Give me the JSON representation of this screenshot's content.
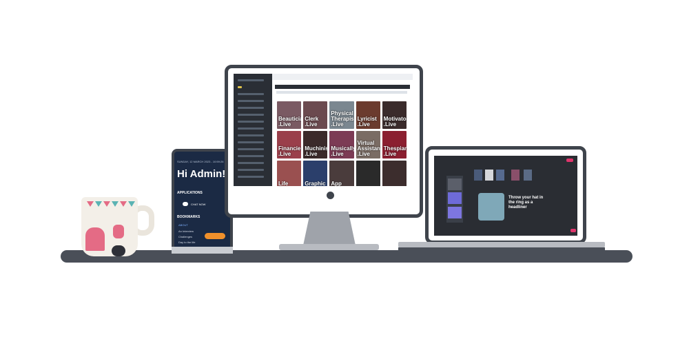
{
  "monitor": {
    "tiles": [
      {
        "label": "Beauticians\n.Live",
        "color": "#7a5a63"
      },
      {
        "label": "Clerk\n.Live",
        "color": "#6b4a4f"
      },
      {
        "label": "Physical\nTherapist\n.Live",
        "color": "#7b8790"
      },
      {
        "label": "Lyricist\n.Live",
        "color": "#6b3b2e"
      },
      {
        "label": "Motivators\n.Live",
        "color": "#3a2b2b"
      },
      {
        "label": "Financier\n.Live",
        "color": "#9a3f4b"
      },
      {
        "label": "Muchinist\n.Live",
        "color": "#3b2a2a"
      },
      {
        "label": "Musically\n.Live",
        "color": "#7c3b55"
      },
      {
        "label": "Virtual\nAssistants\n.Live",
        "color": "#7a6c64"
      },
      {
        "label": "Thespian\n.Live",
        "color": "#8b1f30"
      },
      {
        "label": "Life",
        "color": "#9a5050"
      },
      {
        "label": "Graphic",
        "color": "#2b3f6b"
      },
      {
        "label": "App",
        "color": "#4a3c3c"
      },
      {
        "label": "",
        "color": "#2a2a2a"
      },
      {
        "label": "",
        "color": "#3c2d2d"
      }
    ]
  },
  "phone": {
    "date": "SUNDAY, 12 MARCH 2023 - 10:59:26",
    "greeting": "Hi Admin!",
    "applications_heading": "APPLICATIONS",
    "chat_label": "CHAT NOW",
    "bookmarks_heading": "BOOKMARKS",
    "links": [
      "ABOUT",
      "An Interview",
      "Challenges",
      "Day to the life",
      "Ubinns"
    ]
  },
  "laptop": {
    "headline": "Throw your hat in the ring as a headliner"
  }
}
